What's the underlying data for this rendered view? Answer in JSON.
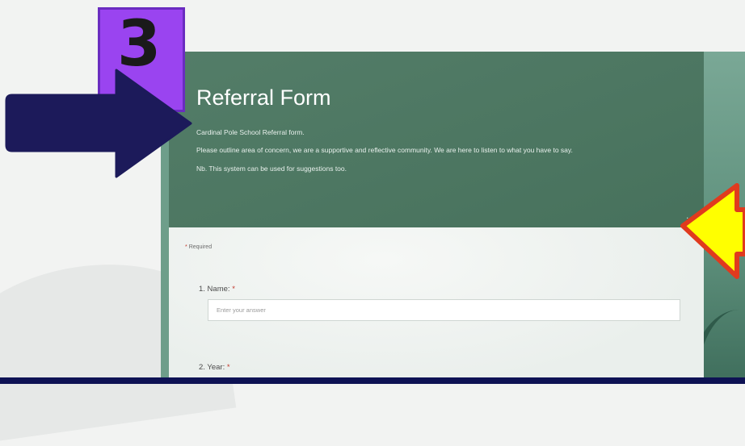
{
  "step_badge": {
    "number": "3"
  },
  "form": {
    "title": "Referral Form",
    "description_lines": [
      "Cardinal Pole School Referral form.",
      "Please outline area of concern, we are a supportive and reflective community. We are here to listen to what you have to say.",
      "Nb. This system can be used for suggestions too."
    ],
    "more_options": "...",
    "required_note": "Required",
    "required_marker": "*",
    "questions": [
      {
        "label": "1. Name:",
        "required_marker": "*",
        "placeholder": "Enter your answer"
      },
      {
        "label": "2. Year:",
        "required_marker": "*"
      }
    ]
  },
  "colors": {
    "header_green": "#4a7660",
    "badge_purple": "#9a44f0",
    "arrow_navy": "#1c1a5a",
    "arrow_yellow": "#ffff00",
    "arrow_outline_red": "#e03a1e"
  },
  "icons": [
    "navy-arrow-icon",
    "yellow-arrow-icon"
  ]
}
